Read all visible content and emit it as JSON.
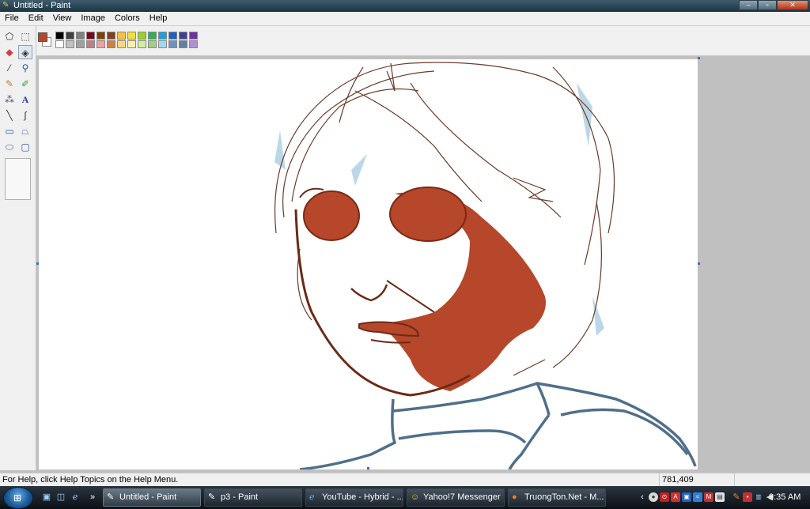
{
  "window": {
    "title": "Untitled - Paint"
  },
  "menu": [
    "File",
    "Edit",
    "View",
    "Image",
    "Colors",
    "Help"
  ],
  "colors": {
    "foreground": "#b6472a",
    "background": "#ffffff",
    "palette": [
      "#000000",
      "#404040",
      "#808080",
      "#800020",
      "#804000",
      "#804020",
      "#f4c242",
      "#f0e040",
      "#9bd030",
      "#30b050",
      "#20a0e0",
      "#2060c0",
      "#404090",
      "#7030a0",
      "#ffffff",
      "#c0c0c0",
      "#a0a0a0",
      "#c08080",
      "#f0a0a0",
      "#d08040",
      "#f8d880",
      "#f8f0b0",
      "#d0f0a0",
      "#a0d080",
      "#a0d8f0",
      "#7090c0",
      "#6080a0",
      "#b090d0"
    ]
  },
  "tools": [
    "free-select",
    "rect-select",
    "eraser",
    "fill",
    "color-picker",
    "magnifier",
    "pencil",
    "brush",
    "airbrush",
    "text",
    "line",
    "curve",
    "rectangle",
    "polygon",
    "ellipse",
    "rounded-rectangle"
  ],
  "status": {
    "help": "For Help, click Help Topics on the Help Menu.",
    "coords": "781,409"
  },
  "taskbar": {
    "tasks": [
      {
        "label": "Untitled - Paint",
        "icon": "paint-icon",
        "active": true
      },
      {
        "label": "p3 - Paint",
        "icon": "paint-icon",
        "active": false
      },
      {
        "label": "YouTube - Hybrid - ...",
        "icon": "ie-icon",
        "active": false
      },
      {
        "label": "Yahoo!7 Messenger",
        "icon": "yahoo-icon",
        "active": false
      },
      {
        "label": "TruongTon.Net - M...",
        "icon": "firefox-icon",
        "active": false
      }
    ],
    "clock": "9:35 AM"
  }
}
